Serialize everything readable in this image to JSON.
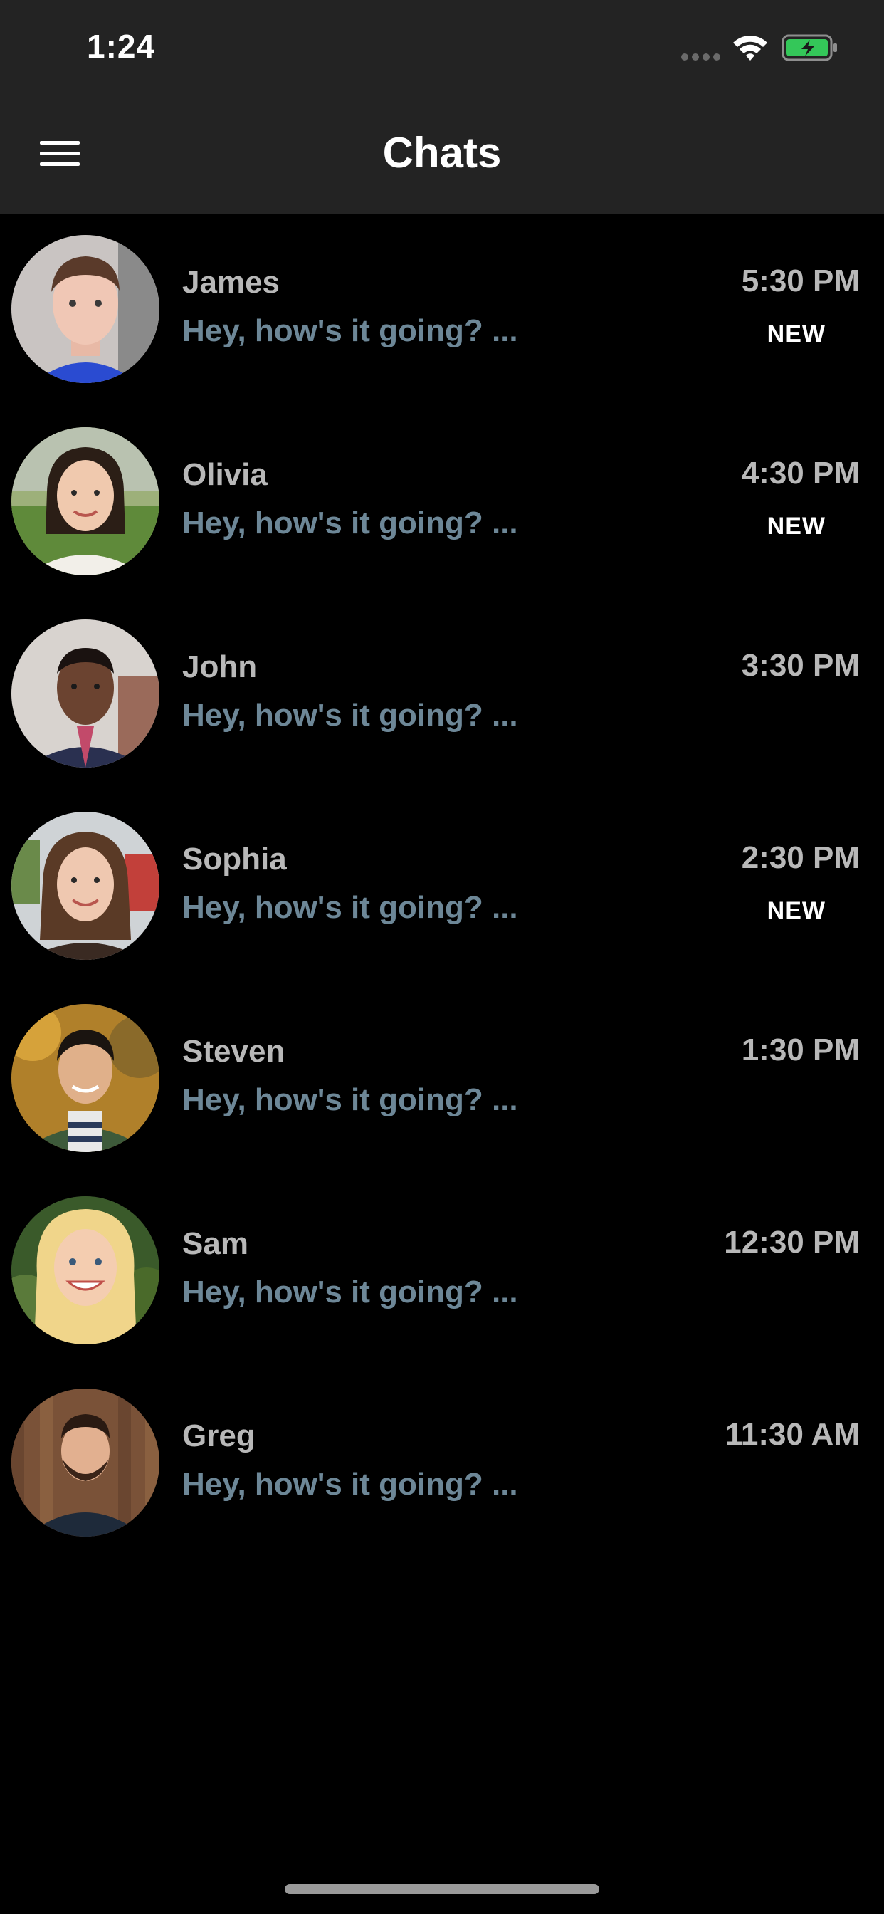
{
  "status_bar": {
    "time": "1:24",
    "icons": [
      "signal-icon",
      "wifi-icon",
      "battery-charging-icon"
    ],
    "battery_color": "#34c759"
  },
  "header": {
    "title": "Chats",
    "menu_icon": "hamburger-menu-icon"
  },
  "colors": {
    "background": "#000000",
    "header_bg": "#232323",
    "name_text": "#b8b8b8",
    "preview_text": "#6d8797",
    "badge_text": "#ffffff"
  },
  "chats": [
    {
      "name": "James",
      "preview": "Hey, how's it going? ...",
      "time": "5:30 PM",
      "badge": "NEW",
      "avatar_icon": "avatar-james"
    },
    {
      "name": "Olivia",
      "preview": "Hey, how's it going? ...",
      "time": "4:30 PM",
      "badge": "NEW",
      "avatar_icon": "avatar-olivia"
    },
    {
      "name": "John",
      "preview": "Hey, how's it going? ...",
      "time": "3:30 PM",
      "badge": "",
      "avatar_icon": "avatar-john"
    },
    {
      "name": "Sophia",
      "preview": "Hey, how's it going? ...",
      "time": "2:30 PM",
      "badge": "NEW",
      "avatar_icon": "avatar-sophia"
    },
    {
      "name": "Steven",
      "preview": "Hey, how's it going? ...",
      "time": "1:30 PM",
      "badge": "",
      "avatar_icon": "avatar-steven"
    },
    {
      "name": "Sam",
      "preview": "Hey, how's it going? ...",
      "time": "12:30 PM",
      "badge": "",
      "avatar_icon": "avatar-sam"
    },
    {
      "name": "Greg",
      "preview": "Hey, how's it going? ...",
      "time": "11:30 AM",
      "badge": "",
      "avatar_icon": "avatar-greg"
    }
  ]
}
